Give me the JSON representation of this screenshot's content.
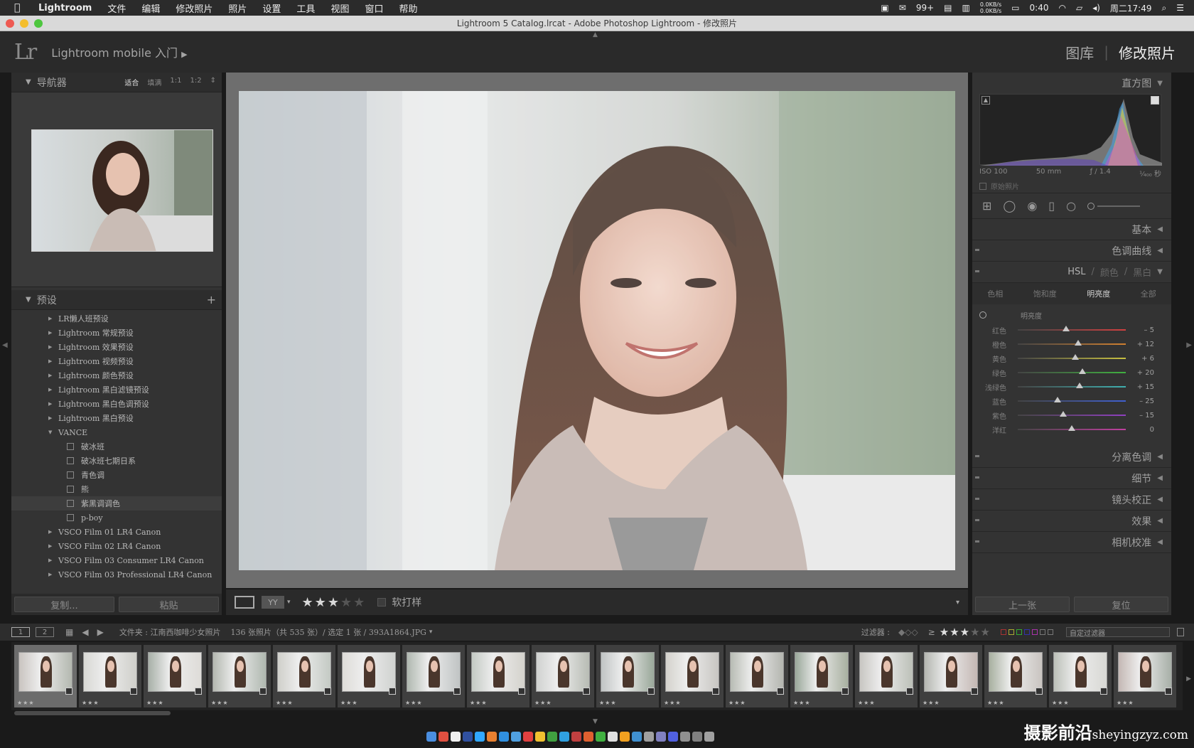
{
  "menubar": {
    "items": [
      "Lightroom",
      "文件",
      "编辑",
      "修改照片",
      "照片",
      "设置",
      "工具",
      "视图",
      "窗口",
      "帮助"
    ],
    "badge": "99+",
    "battery": "0:40",
    "net_up": "0.0KB/s",
    "net_down": "0.0KB/s",
    "clock": "周二17:49"
  },
  "titlebar": {
    "title": "Lightroom 5 Catalog.lrcat - Adobe Photoshop Lightroom - 修改照片"
  },
  "topbar": {
    "logo": "Lr",
    "identity": "Lightroom mobile 入门",
    "module_library": "图库",
    "module_develop": "修改照片"
  },
  "navigator": {
    "title": "导航器",
    "options": [
      "适合",
      "填满",
      "1:1",
      "1:2"
    ]
  },
  "presets": {
    "title": "预设",
    "add": "+",
    "items": [
      {
        "label": "LR懒人班预设",
        "type": "folder"
      },
      {
        "label": "Lightroom 常规预设",
        "type": "folder"
      },
      {
        "label": "Lightroom 效果预设",
        "type": "folder"
      },
      {
        "label": "Lightroom 视频预设",
        "type": "folder"
      },
      {
        "label": "Lightroom 颜色预设",
        "type": "folder"
      },
      {
        "label": "Lightroom 黑白滤镜预设",
        "type": "folder"
      },
      {
        "label": "Lightroom 黑白色调预设",
        "type": "folder"
      },
      {
        "label": "Lightroom 黑白预设",
        "type": "folder"
      },
      {
        "label": "VANCE",
        "type": "open"
      },
      {
        "label": "破冰班",
        "type": "preset"
      },
      {
        "label": "破冰班七期日系",
        "type": "preset"
      },
      {
        "label": "青色调",
        "type": "preset"
      },
      {
        "label": "熊",
        "type": "preset"
      },
      {
        "label": "紫黑调调色",
        "type": "preset"
      },
      {
        "label": "p-boy",
        "type": "preset"
      },
      {
        "label": "VSCO Film 01 LR4 Canon",
        "type": "folder"
      },
      {
        "label": "VSCO Film 02 LR4 Canon",
        "type": "folder"
      },
      {
        "label": "VSCO Film 03 Consumer LR4 Canon",
        "type": "folder"
      },
      {
        "label": "VSCO Film 03 Professional LR4 Canon",
        "type": "folder"
      }
    ],
    "copy": "复制...",
    "paste": "粘贴"
  },
  "toolbar": {
    "rating": 3,
    "softproof": "软打样"
  },
  "histogram": {
    "title": "直方图",
    "iso": "ISO 100",
    "focal": "50 mm",
    "aperture": "ƒ / 1.4",
    "shutter": "¹⁄₄₀₀ 秒",
    "original": "原始照片"
  },
  "panels": {
    "basic": "基本",
    "tonecurve": "色调曲线",
    "hsl_label": "HSL",
    "hsl_sep": "/",
    "color_label": "颜色",
    "bw_label": "黑白",
    "split": "分离色调",
    "detail": "细节",
    "lens": "镜头校正",
    "effects": "效果",
    "camera": "相机校准"
  },
  "hsl": {
    "tabs": [
      "色相",
      "饱和度",
      "明亮度",
      "全部"
    ],
    "active_tab": 2,
    "section": "明亮度",
    "sliders": [
      {
        "name": "红色",
        "value": "– 5",
        "pos": 0.45,
        "color": "#d04040"
      },
      {
        "name": "橙色",
        "value": "+ 12",
        "pos": 0.56,
        "color": "#d08030"
      },
      {
        "name": "黄色",
        "value": "+ 6",
        "pos": 0.53,
        "color": "#c8c040"
      },
      {
        "name": "绿色",
        "value": "+ 20",
        "pos": 0.6,
        "color": "#40b040"
      },
      {
        "name": "浅绿色",
        "value": "+ 15",
        "pos": 0.57,
        "color": "#40b0b0"
      },
      {
        "name": "蓝色",
        "value": "– 25",
        "pos": 0.37,
        "color": "#4060d0"
      },
      {
        "name": "紫色",
        "value": "– 15",
        "pos": 0.42,
        "color": "#9040c0"
      },
      {
        "name": "洋红",
        "value": "0",
        "pos": 0.5,
        "color": "#c040a0"
      }
    ]
  },
  "right_buttons": {
    "prev": "上一张",
    "reset": "复位"
  },
  "filmbar": {
    "page1": "1",
    "page2": "2",
    "source": "文件夹 : 江南西咖啡少女照片",
    "count": "136 张照片（共 535 张）/ 选定 1 张 / 393A1864.JPG",
    "filter_label": "过滤器 :",
    "ge": "≥",
    "filter_stars": 3,
    "custom_filter": "自定过滤器"
  },
  "filmstrip": {
    "count": 18,
    "selected": 0
  },
  "watermark": {
    "cn": "摄影前沿",
    "url": "sheyingzyz.com"
  }
}
